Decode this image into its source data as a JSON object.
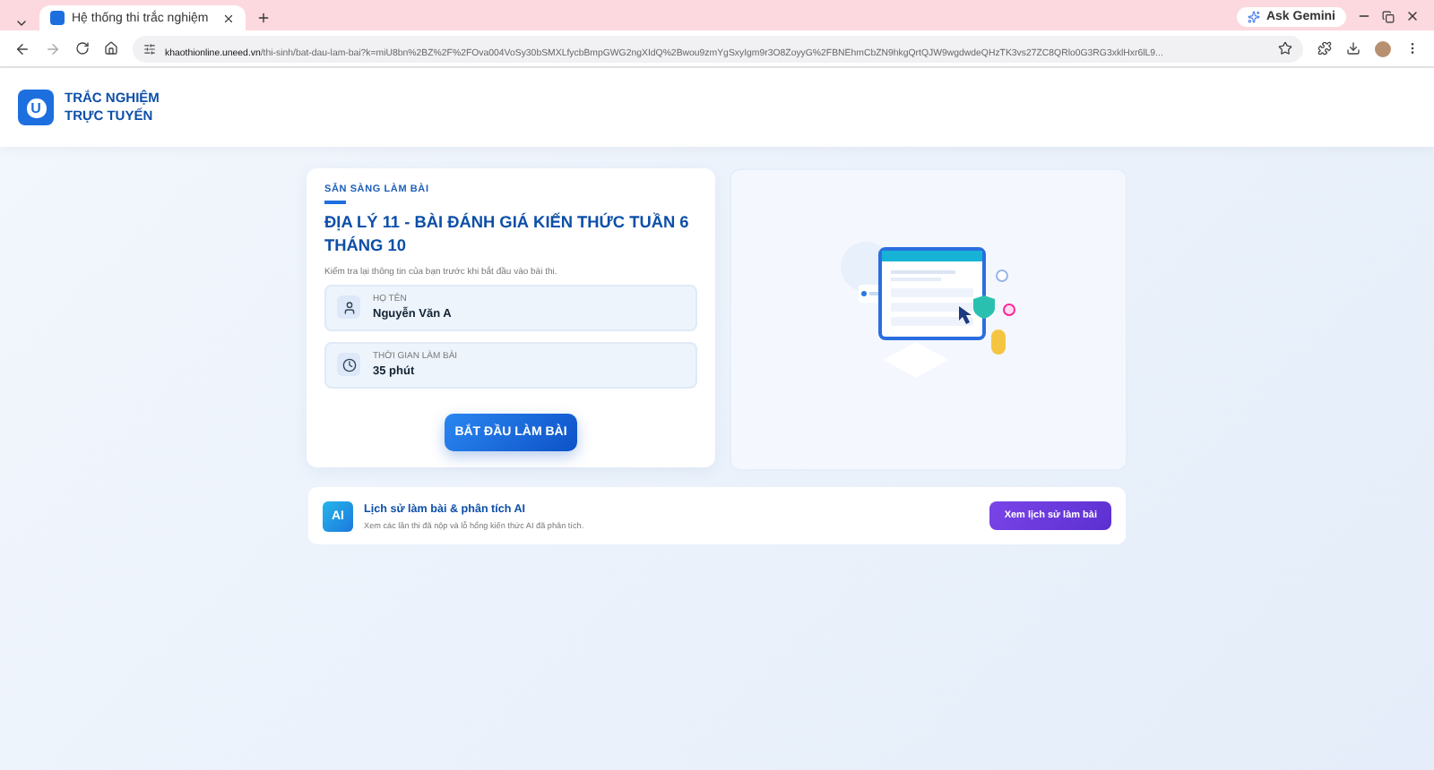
{
  "browser": {
    "tab_title": "Hệ thống thi trắc nghiệm",
    "url_domain": "khaothionline.uneed.vn",
    "url_path": "/thi-sinh/bat-dau-lam-bai?k=miU8bn%2BZ%2F%2FOva004VoSy30bSMXLfycbBmpGWG2ngXIdQ%2Bwou9zmYgSxyIgm9r3O8ZoyyG%2FBNEhmCbZN9hkgQrtQJW9wgdwdeQHzTK3vs27ZC8QRlo0G3RG3xklHxr6lL9...",
    "gemini": "Ask Gemini"
  },
  "brand": {
    "line1": "TRẮC NGHIỆM",
    "line2": "TRỰC TUYẾN",
    "logo_letter": "U"
  },
  "exam": {
    "eyebrow": "SẴN SÀNG LÀM BÀI",
    "title": "ĐỊA LÝ 11 - BÀI ĐÁNH GIÁ KIẾN THỨC TUẦN 6 THÁNG 10",
    "subtitle": "Kiểm tra lại thông tin của bạn trước khi bắt đầu vào bài thi.",
    "fields": [
      {
        "kind": "person",
        "label": "HỌ TÊN",
        "value": "Nguyễn Văn A"
      },
      {
        "kind": "time",
        "label": "THỜI GIAN LÀM BÀI",
        "value": "35 phút"
      }
    ],
    "start_button": "BẮT ĐẦU LÀM BÀI"
  },
  "history": {
    "badge": "AI",
    "title": "Lịch sử làm bài & phân tích AI",
    "description": "Xem các lần thi đã nộp và lỗ hổng kiến thức AI đã phân tích.",
    "button": "Xem lịch sử làm bài"
  }
}
